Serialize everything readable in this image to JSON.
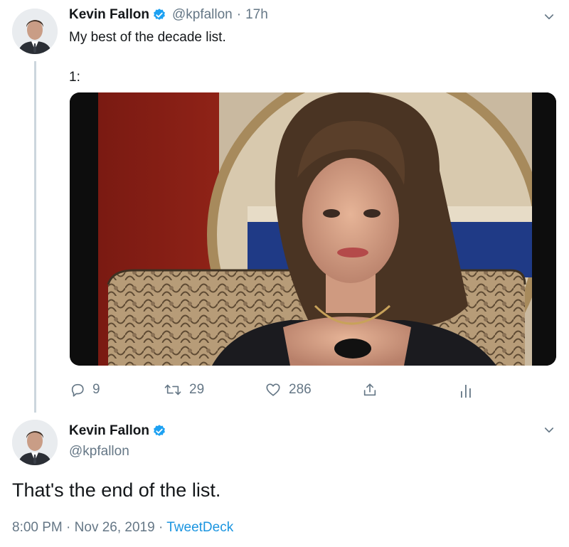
{
  "tweet1": {
    "author_name": "Kevin Fallon",
    "author_handle": "@kpfallon",
    "separator": "·",
    "time": "17h",
    "text": "My best of the decade list.",
    "subtext": "1:",
    "media_alt": "Still of a woman with a 1960s hairstyle sitting in a snakeskin booth",
    "actions": {
      "replies": "9",
      "retweets": "29",
      "likes": "286"
    }
  },
  "tweet2": {
    "author_name": "Kevin Fallon",
    "author_handle": "@kpfallon",
    "text": "That's the end of the list.",
    "time": "8:00 PM",
    "date": "Nov 26, 2019",
    "source": "TweetDeck",
    "sep1": "·",
    "sep2": "·"
  },
  "colors": {
    "verified": "#1da1f2",
    "muted": "#657786",
    "link": "#1b95e0",
    "thread_line": "#ccd6dd"
  },
  "icons": [
    "verified-badge-icon",
    "chevron-down-icon",
    "reply-icon",
    "retweet-icon",
    "like-icon",
    "share-icon",
    "analytics-icon"
  ]
}
